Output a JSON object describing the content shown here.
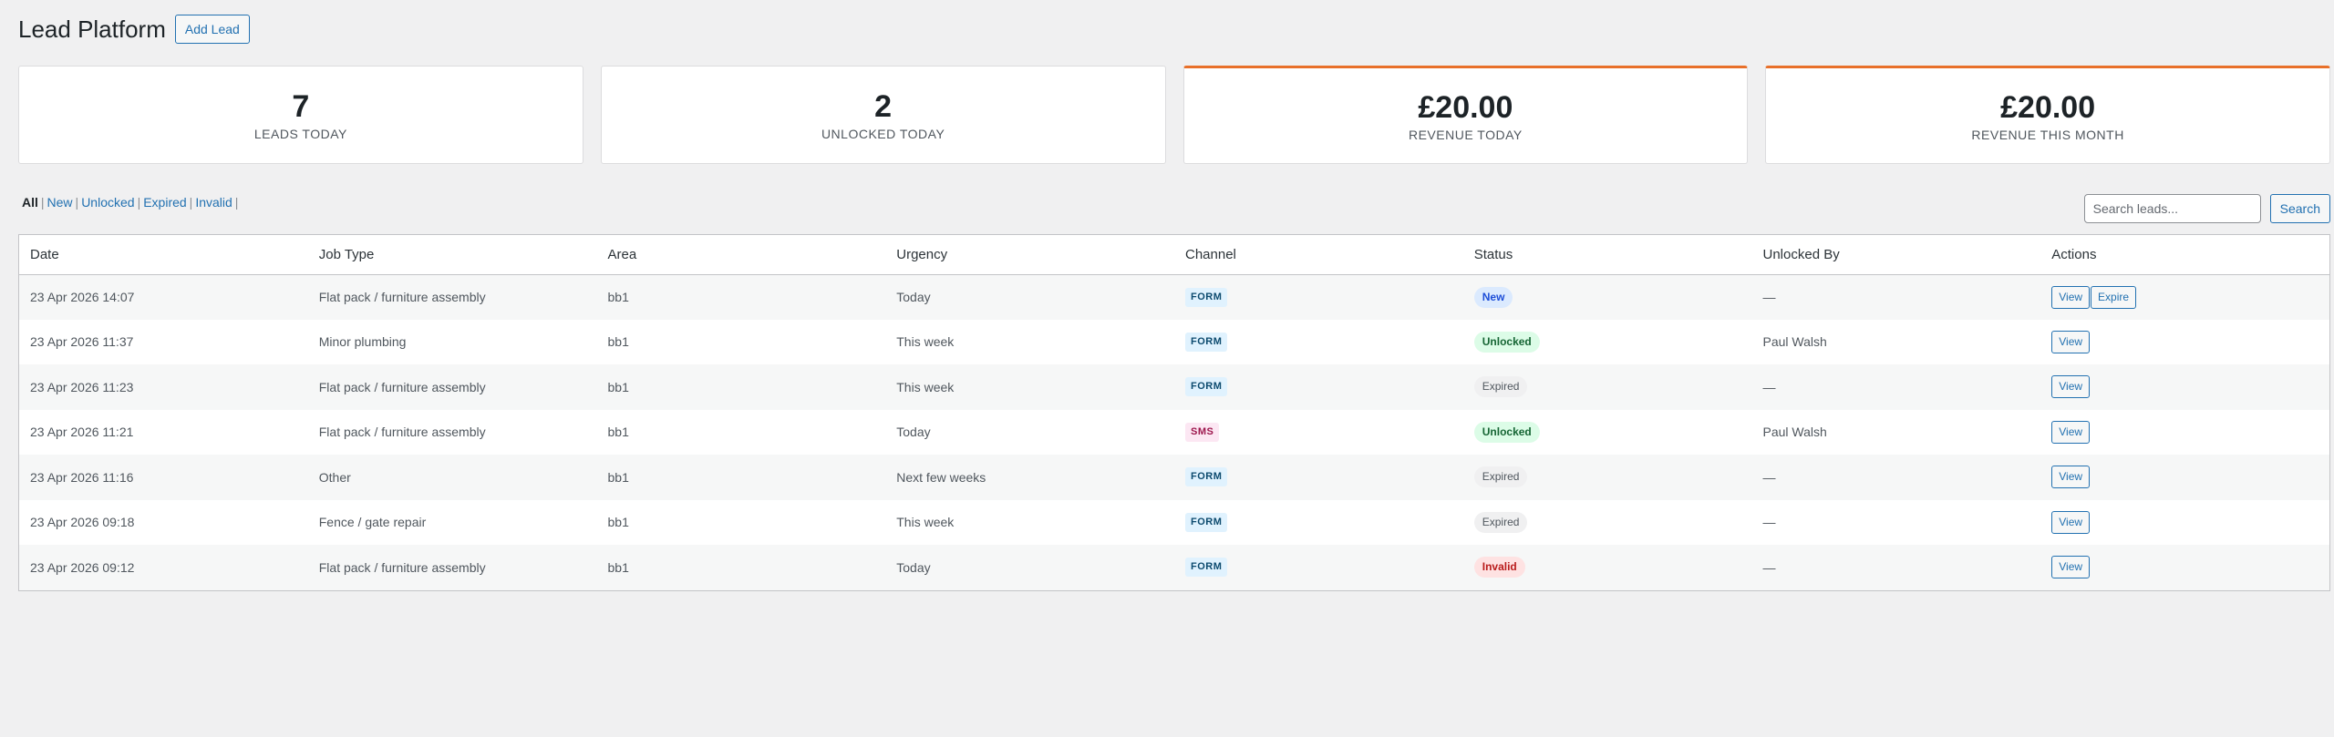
{
  "header": {
    "title": "Lead Platform",
    "add_button": "Add Lead"
  },
  "stats": [
    {
      "value": "7",
      "label": "LEADS TODAY",
      "accent": false
    },
    {
      "value": "2",
      "label": "UNLOCKED TODAY",
      "accent": false
    },
    {
      "value": "£20.00",
      "label": "REVENUE TODAY",
      "accent": true
    },
    {
      "value": "£20.00",
      "label": "REVENUE THIS MONTH",
      "accent": true
    }
  ],
  "colors": {
    "accent": "#e8702a",
    "link": "#2271b1"
  },
  "filters": [
    {
      "label": "All",
      "current": true
    },
    {
      "label": "New",
      "current": false
    },
    {
      "label": "Unlocked",
      "current": false
    },
    {
      "label": "Expired",
      "current": false
    },
    {
      "label": "Invalid",
      "current": false
    }
  ],
  "search": {
    "placeholder": "Search leads...",
    "value": "",
    "button": "Search"
  },
  "table": {
    "columns": [
      "Date",
      "Job Type",
      "Area",
      "Urgency",
      "Channel",
      "Status",
      "Unlocked By",
      "Actions"
    ],
    "rows": [
      {
        "date": "23 Apr 2026 14:07",
        "job_type": "Flat pack / furniture assembly",
        "area": "bb1",
        "urgency": "Today",
        "channel": "FORM",
        "status": "New",
        "unlocked_by": "—",
        "actions": [
          "View",
          "Expire"
        ]
      },
      {
        "date": "23 Apr 2026 11:37",
        "job_type": "Minor plumbing",
        "area": "bb1",
        "urgency": "This week",
        "channel": "FORM",
        "status": "Unlocked",
        "unlocked_by": "Paul Walsh",
        "actions": [
          "View"
        ]
      },
      {
        "date": "23 Apr 2026 11:23",
        "job_type": "Flat pack / furniture assembly",
        "area": "bb1",
        "urgency": "This week",
        "channel": "FORM",
        "status": "Expired",
        "unlocked_by": "—",
        "actions": [
          "View"
        ]
      },
      {
        "date": "23 Apr 2026 11:21",
        "job_type": "Flat pack / furniture assembly",
        "area": "bb1",
        "urgency": "Today",
        "channel": "SMS",
        "status": "Unlocked",
        "unlocked_by": "Paul Walsh",
        "actions": [
          "View"
        ]
      },
      {
        "date": "23 Apr 2026 11:16",
        "job_type": "Other",
        "area": "bb1",
        "urgency": "Next few weeks",
        "channel": "FORM",
        "status": "Expired",
        "unlocked_by": "—",
        "actions": [
          "View"
        ]
      },
      {
        "date": "23 Apr 2026 09:18",
        "job_type": "Fence / gate repair",
        "area": "bb1",
        "urgency": "This week",
        "channel": "FORM",
        "status": "Expired",
        "unlocked_by": "—",
        "actions": [
          "View"
        ]
      },
      {
        "date": "23 Apr 2026 09:12",
        "job_type": "Flat pack / furniture assembly",
        "area": "bb1",
        "urgency": "Today",
        "channel": "FORM",
        "status": "Invalid",
        "unlocked_by": "—",
        "actions": [
          "View"
        ]
      }
    ]
  }
}
